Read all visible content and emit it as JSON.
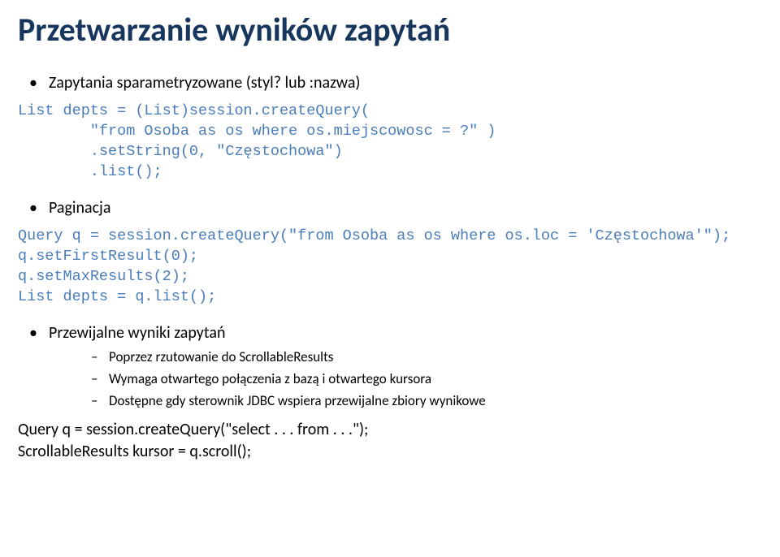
{
  "title": "Przetwarzanie wyników zapytań",
  "bullet1": "Zapytania sparametryzowane (styl? lub :nazwa)",
  "code1": "List depts = (List)session.createQuery(\n        \"from Osoba as os where os.miejscowosc = ?\" )\n        .setString(0, \"Częstochowa\")\n        .list();",
  "bullet2": "Paginacja",
  "code2": "Query q = session.createQuery(\"from Osoba as os where os.loc = 'Częstochowa'\");\nq.setFirstResult(0);\nq.setMaxResults(2);\nList depts = q.list();",
  "bullet3": "Przewijalne wyniki zapytań",
  "dashes": [
    "Poprzez rzutowanie do ScrollableResults",
    "Wymaga otwartego połączenia z bazą i otwartego kursora",
    "Dostępne gdy sterownik JDBC wspiera przewijalne zbiory wynikowe"
  ],
  "code3": "Query q = session.createQuery(\"select . . . from . . .\");\nScrollableResults kursor = q.scroll();"
}
